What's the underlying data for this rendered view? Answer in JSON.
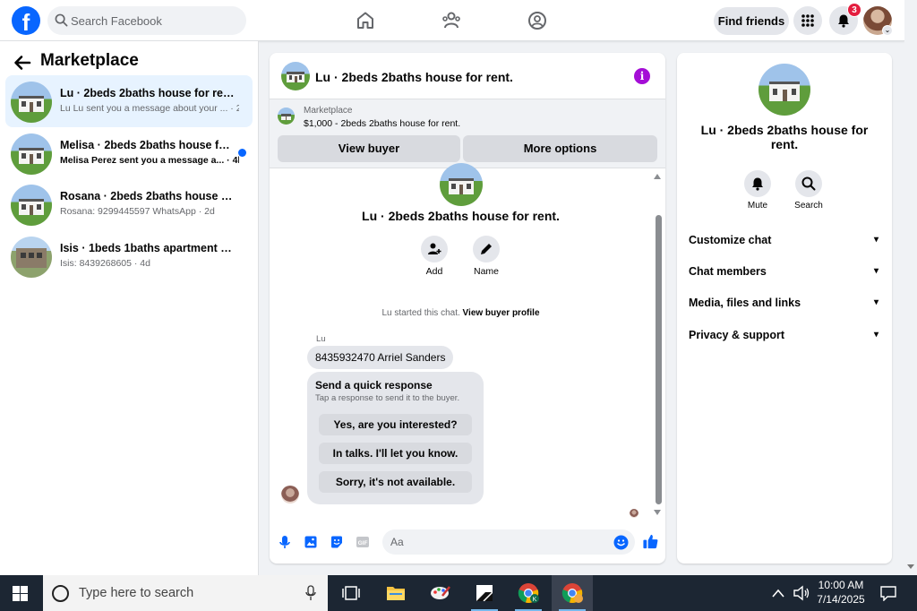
{
  "topbar": {
    "logo": "f",
    "search_placeholder": "Search Facebook",
    "find_friends": "Find friends",
    "notification_count": "3",
    "icons": [
      "home-icon",
      "friends-icon",
      "groups-icon",
      "menu-grid-icon",
      "bell-icon"
    ]
  },
  "sidebar": {
    "title": "Marketplace",
    "conversations": [
      {
        "title": "Lu · 2beds 2baths house for rent.",
        "subtitle": "Lu Lu sent you a message about your ... · 2h",
        "active": true,
        "unread": false
      },
      {
        "title": "Melisa · 2beds 2baths house for ...",
        "subtitle": "Melisa Perez sent you a message a... · 4h",
        "active": false,
        "unread": true
      },
      {
        "title": "Rosana · 2beds 2baths house for r...",
        "subtitle": "Rosana: 9299445597 WhatsApp · 2d",
        "active": false,
        "unread": false
      },
      {
        "title": "Isis · 1beds 1baths apartment for r...",
        "subtitle": "Isis: 8439268605 · 4d",
        "active": false,
        "unread": false
      }
    ]
  },
  "chat": {
    "title": "Lu · 2beds 2baths house for rent.",
    "listing_label": "Marketplace",
    "listing_price": "$1,000 - 2beds 2baths house for rent.",
    "view_buyer": "View buyer",
    "more_options": "More options",
    "center_title": "Lu · 2beds 2baths house for rent.",
    "add_label": "Add",
    "name_label": "Name",
    "system_note": "Lu started this chat.",
    "system_link": "View buyer profile",
    "sender": "Lu",
    "message": "8435932470 Arriel Sanders",
    "quick_title": "Send a quick response",
    "quick_sub": "Tap a response to send it to the buyer.",
    "quick_replies": [
      "Yes, are you interested?",
      "In talks. I'll let you know.",
      "Sorry, it's not available."
    ],
    "composer_placeholder": "Aa",
    "accent": "#0866ff"
  },
  "rpanel": {
    "title": "Lu · 2beds 2baths house for rent.",
    "mute": "Mute",
    "search": "Search",
    "sections": [
      "Customize chat",
      "Chat members",
      "Media, files and links",
      "Privacy & support"
    ]
  },
  "taskbar": {
    "search_placeholder": "Type here to search",
    "time": "10:00 AM",
    "date": "7/14/2025"
  }
}
